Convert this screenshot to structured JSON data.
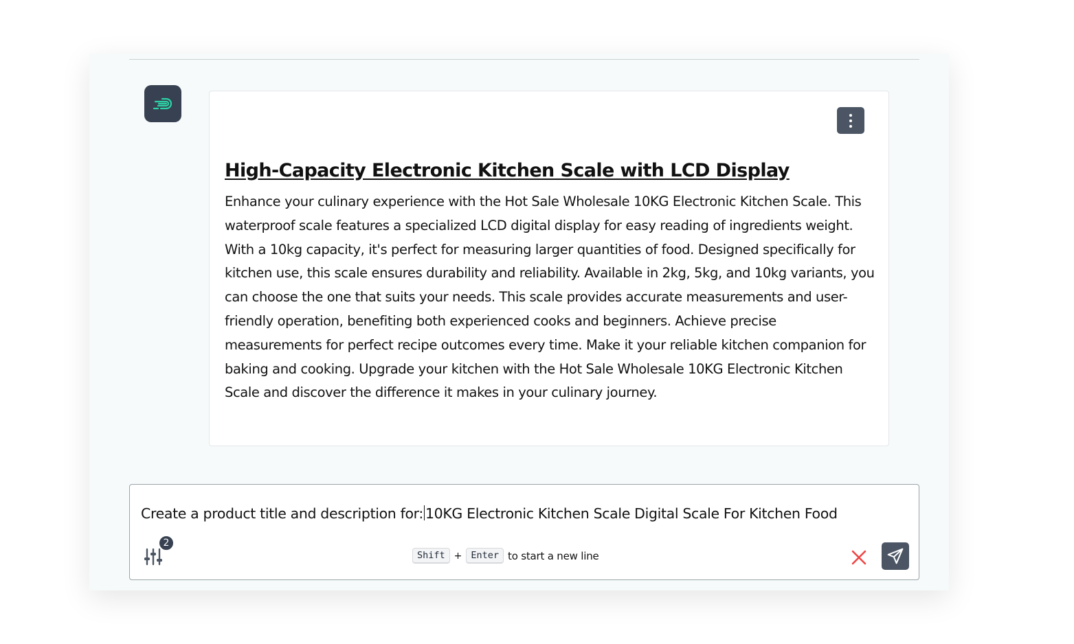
{
  "assistant": {
    "avatar_icon": "logo-wind-icon"
  },
  "message": {
    "menu_icon": "kebab-menu-icon",
    "title": "High-Capacity Electronic Kitchen Scale with LCD Display",
    "description": "Enhance your culinary experience with the Hot Sale Wholesale 10KG Electronic Kitchen Scale. This waterproof scale features a specialized LCD digital display for easy reading of ingredients weight. With a 10kg capacity, it's perfect for measuring larger quantities of food. Designed specifically for kitchen use, this scale ensures durability and reliability. Available in 2kg, 5kg, and 10kg variants, you can choose the one that suits your needs. This scale provides accurate measurements and user-friendly operation, benefiting both experienced cooks and beginners. Achieve precise measurements for perfect recipe outcomes every time. Make it your reliable kitchen companion for baking and cooking. Upgrade your kitchen with the Hot Sale Wholesale 10KG Electronic Kitchen Scale and discover the difference it makes in your culinary journey."
  },
  "composer": {
    "prompt_before_cursor": "Create a product title and description for:",
    "prompt_after_cursor": "10KG Electronic Kitchen Scale Digital Scale For Kitchen Food",
    "settings_icon": "sliders-icon",
    "settings_badge": "2",
    "hint_key_1": "Shift",
    "hint_plus": "+",
    "hint_key_2": "Enter",
    "hint_text": "to start a new line",
    "clear_icon": "close-icon",
    "send_icon": "send-icon"
  },
  "colors": {
    "panel_bg": "#f6fafa",
    "dark_button": "#4b5563",
    "avatar_bg": "#374151",
    "logo_accent": "#2dd4a7",
    "clear_red": "#ef4444"
  }
}
